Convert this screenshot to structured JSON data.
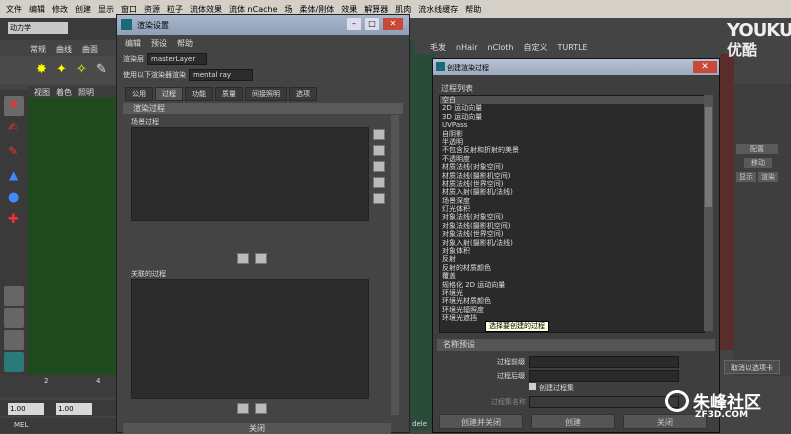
{
  "menubar": [
    "文件",
    "编辑",
    "修改",
    "创建",
    "显示",
    "窗口",
    "资源",
    "粒子",
    "流体效果",
    "流体 nCache",
    "场",
    "柔体/刚体",
    "效果",
    "解算器",
    "肌肉",
    "流水线缓存",
    "帮助"
  ],
  "main": {
    "mode": "动力学",
    "shelf_tabs": [
      "常规",
      "曲线",
      "曲面"
    ],
    "panel_menu": [
      "视图",
      "着色",
      "照明"
    ],
    "timeline_ticks": [
      "2",
      "4"
    ],
    "range_start": "1.00",
    "range_end": "1.00",
    "cmd_label": "MEL",
    "right_shelf_tabs": [
      "毛发",
      "nHair",
      "nCloth",
      "自定义",
      "TURTLE"
    ],
    "right_panel": {
      "btn1": "配置",
      "btn2": "移动",
      "btn3": "显示",
      "btn4": "渲染"
    },
    "anim_btn": "取消以选项卡",
    "dele": "dele"
  },
  "render_settings": {
    "title": "渲染设置",
    "menus": [
      "编辑",
      "预设",
      "帮助"
    ],
    "layer_label": "渲染层",
    "layer_value": "masterLayer",
    "renderer_label": "使用以下渲染器渲染",
    "renderer_value": "mental ray",
    "tabs": [
      "公用",
      "过程",
      "功能",
      "质量",
      "间接照明",
      "选项"
    ],
    "section": "渲染过程",
    "scene_passes": "场景过程",
    "assoc_passes": "关联的过程",
    "close": "关闭"
  },
  "create_pass": {
    "title": "创建渲染过程",
    "list_label": "过程列表",
    "passes": [
      "空白",
      "2D 运动向量",
      "3D 运动向量",
      "UVPass",
      "自阴影",
      "半透明",
      "不包含反射和折射的美景",
      "不透明度",
      "材质法线(对象空间)",
      "材质法线(摄影机空间)",
      "材质法线(世界空间)",
      "材质入射(摄影机/法线)",
      "场景深度",
      "灯光体积",
      "对象法线(对象空间)",
      "对象法线(摄影机空间)",
      "对象法线(世界空间)",
      "对象入射(摄影机/法线)",
      "对象体积",
      "反射",
      "反射的材质颜色",
      "覆盖",
      "规格化 2D 运动向量",
      "环境光",
      "环境光材质颜色",
      "环境光辐照度",
      "环境光遮挡"
    ],
    "tooltip": "选择要创建的过程",
    "preset_header": "名称预设",
    "prefix_label": "过程前缀",
    "suffix_label": "过程后缀",
    "create_set_label": "创建过程集",
    "set_name_label": "过程集名称",
    "btn_create_close": "创建并关闭",
    "btn_create": "创建",
    "btn_close": "关闭"
  },
  "watermarks": {
    "youku_en": "YOUKU",
    "youku_cn": "优酷",
    "site_cn": "朱峰社区",
    "site_en": "ZF3D.COM"
  }
}
